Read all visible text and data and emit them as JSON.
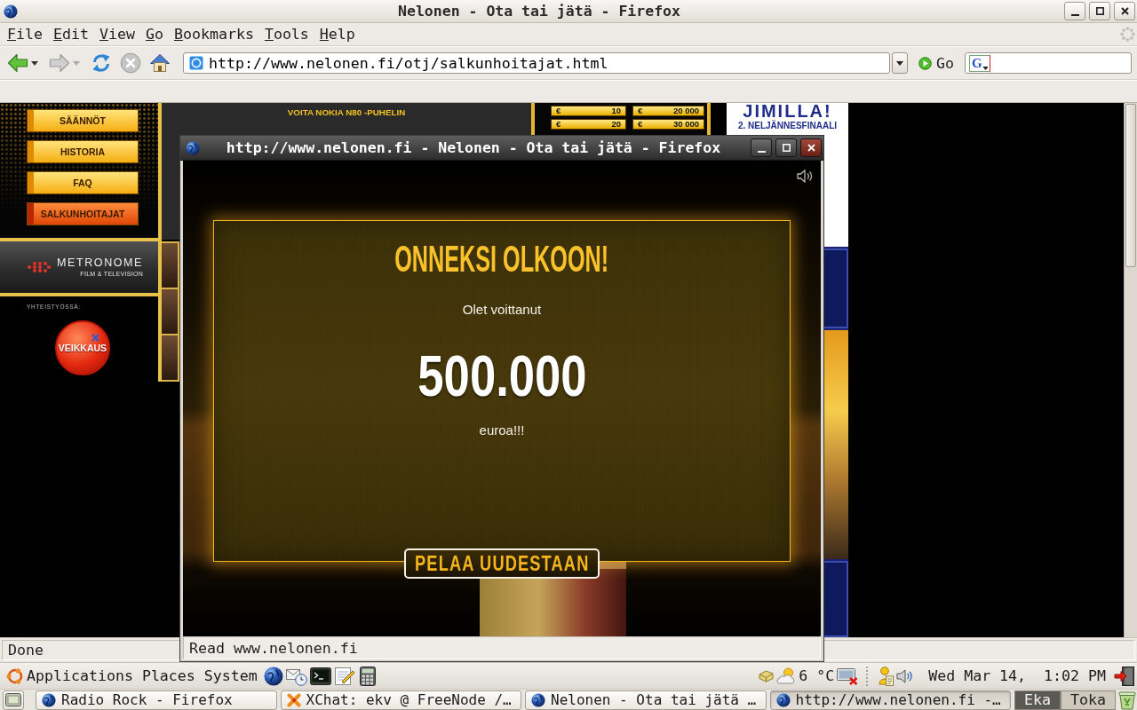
{
  "main_window": {
    "title": "Nelonen - Ota tai jätä - Firefox",
    "menu": [
      "File",
      "Edit",
      "View",
      "Go",
      "Bookmarks",
      "Tools",
      "Help"
    ],
    "nav_buttons": [
      {
        "kind": "back",
        "disabled": false
      },
      {
        "kind": "forward",
        "disabled": true
      },
      {
        "kind": "reload",
        "disabled": false
      },
      {
        "kind": "stop",
        "disabled": true
      },
      {
        "kind": "home",
        "disabled": false
      }
    ],
    "address": {
      "value": "http://www.nelonen.fi/otj/salkunhoitajat.html"
    },
    "go_button": "Go",
    "search": {
      "engine_letter": "G"
    },
    "status": "Done"
  },
  "page": {
    "menu": [
      {
        "label": "SÄÄNNÖT",
        "selected": false
      },
      {
        "label": "HISTORIA",
        "selected": false
      },
      {
        "label": "FAQ",
        "selected": false
      },
      {
        "label": "SALKUNHOITAJAT",
        "selected": true
      }
    ],
    "studio_logo": {
      "name": "METRONOME",
      "tagline": "FILM & TELEVISION"
    },
    "partner_label": "YHTEISTYÖSSÄ:",
    "partner_logo": "VEIKKAUS",
    "promo": "VOITA NOKIA N80 -PUHELIN",
    "prizes": [
      {
        "currency": "€",
        "amount": "10"
      },
      {
        "currency": "€",
        "amount": "20 000"
      },
      {
        "currency": "€",
        "amount": "20"
      },
      {
        "currency": "€",
        "amount": "30 000"
      }
    ],
    "ad": {
      "headline": "JIMILLA!",
      "subline": "2. NELJÄNNESFINAALI"
    }
  },
  "popup": {
    "title": "http://www.nelonen.fi - Nelonen - Ota tai jätä - Firefox",
    "heading": "ONNEKSI OLKOON!",
    "intro": "Olet voittanut",
    "amount": "500.000",
    "unit": "euroa!!!",
    "button": "PELAA UUDESTAAN",
    "status": "Read www.nelonen.fi"
  },
  "panel": {
    "menus": [
      "Applications",
      "Places",
      "System"
    ],
    "launchers": [
      {
        "kind": "browser"
      },
      {
        "kind": "mail"
      },
      {
        "kind": "terminal"
      },
      {
        "kind": "editor"
      },
      {
        "kind": "calculator"
      }
    ],
    "tray": [
      {
        "kind": "package"
      },
      {
        "kind": "weather",
        "text": "6 °C"
      },
      {
        "kind": "network"
      },
      {
        "kind": "notes"
      },
      {
        "kind": "volume"
      }
    ],
    "clock": "Wed Mar 14,  1:02 PM"
  },
  "taskbar": {
    "tasks": [
      {
        "label": "Radio Rock - Firefox",
        "kind": "browser",
        "selected": false
      },
      {
        "label": "XChat: ekv @ FreeNode /…",
        "kind": "chat",
        "selected": false
      },
      {
        "label": "Nelonen - Ota tai jätä …",
        "kind": "browser",
        "selected": false
      },
      {
        "label": "http://www.nelonen.fi -…",
        "kind": "browser",
        "selected": true
      }
    ],
    "workspaces": [
      {
        "label": "Eka",
        "selected": true
      },
      {
        "label": "Toka",
        "selected": false
      }
    ]
  }
}
